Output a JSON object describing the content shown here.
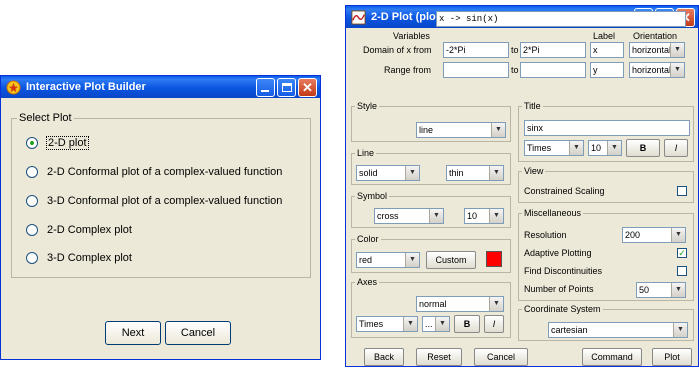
{
  "builder": {
    "title": "Interactive Plot Builder",
    "group_label": "Select Plot",
    "options": [
      {
        "label": "2-D plot",
        "selected": true
      },
      {
        "label": "2-D Conformal plot of a complex-valued function",
        "selected": false
      },
      {
        "label": "3-D Conformal plot of a complex-valued function",
        "selected": false
      },
      {
        "label": "2-D Complex plot",
        "selected": false
      },
      {
        "label": "3-D Complex plot",
        "selected": false
      }
    ],
    "next_label": "Next",
    "cancel_label": "Cancel"
  },
  "plot": {
    "title": "2-D Plot (plot)",
    "expression": "x -> sin(x)",
    "variables": {
      "header_variables": "Variables",
      "header_label": "Label",
      "header_orientation": "Orientation",
      "domain_label": "Domain of x from",
      "domain_from": "-2*Pi",
      "to1": "to",
      "domain_to": "2*Pi",
      "domain_axis_label": "x",
      "domain_orientation": "horizontal",
      "range_label": "Range from",
      "range_from": "",
      "to2": "to",
      "range_to": "",
      "range_axis_label": "y",
      "range_orientation": "horizontal"
    },
    "style": {
      "label": "Style",
      "value": "line"
    },
    "line": {
      "label": "Line",
      "type": "solid",
      "thickness": "thin"
    },
    "symbol": {
      "label": "Symbol",
      "type": "cross",
      "size": "10"
    },
    "color": {
      "label": "Color",
      "value": "red",
      "custom_label": "Custom",
      "swatch": "#ff0000"
    },
    "axes": {
      "label": "Axes",
      "type": "normal",
      "font": "Times",
      "size": "...",
      "bold_label": "B",
      "italic_label": "I"
    },
    "title_section": {
      "label": "Title",
      "text": "sinx",
      "font": "Times",
      "size": "10",
      "bold_label": "B",
      "italic_label": "I"
    },
    "view": {
      "label": "View",
      "constrained_label": "Constrained Scaling",
      "constrained": false
    },
    "misc": {
      "label": "Miscellaneous",
      "resolution_label": "Resolution",
      "resolution": "200",
      "adaptive_label": "Adaptive Plotting",
      "adaptive": true,
      "discont_label": "Find Discontinuities",
      "discont": false,
      "points_label": "Number of Points",
      "points": "50"
    },
    "coords": {
      "label": "Coordinate System",
      "value": "cartesian"
    },
    "buttons": {
      "back": "Back",
      "reset": "Reset",
      "cancel": "Cancel",
      "command": "Command",
      "plot": "Plot"
    }
  },
  "colors": {
    "title_bar": "#0a5be8",
    "window_bg": "#ece9d8",
    "accent_check": "#21a121"
  },
  "icons": {
    "builder_window": "maple-leaf-icon",
    "plot_window": "plot-window-icon"
  }
}
